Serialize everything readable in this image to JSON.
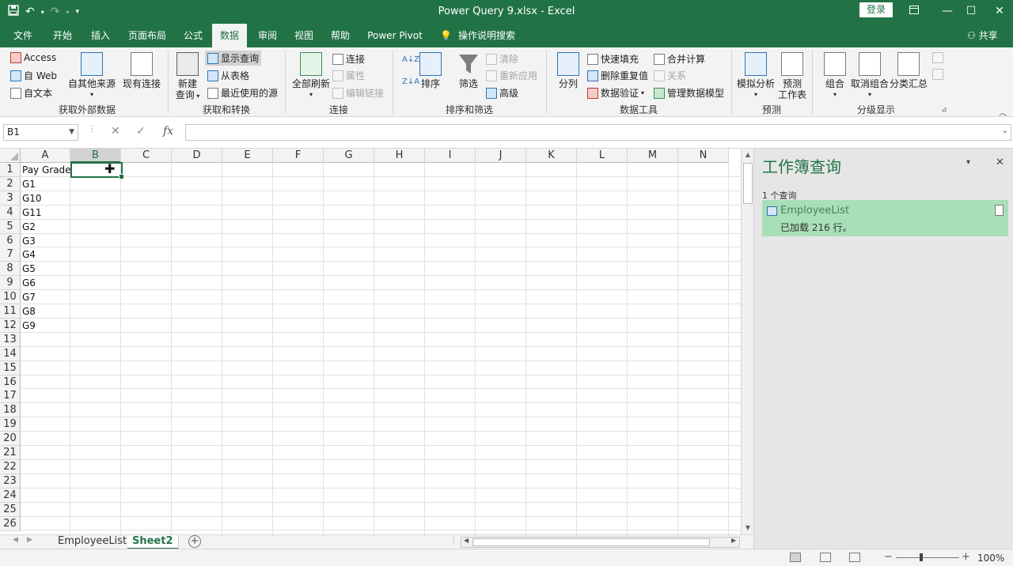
{
  "window": {
    "title": "Power Query 9.xlsx  -  Excel",
    "login_label": "登录",
    "share_label": "共享"
  },
  "tabs": [
    {
      "label": "文件"
    },
    {
      "label": "开始"
    },
    {
      "label": "插入"
    },
    {
      "label": "页面布局"
    },
    {
      "label": "公式"
    },
    {
      "label": "数据"
    },
    {
      "label": "审阅"
    },
    {
      "label": "视图"
    },
    {
      "label": "帮助"
    },
    {
      "label": "Power Pivot"
    }
  ],
  "tell_me": "操作说明搜索",
  "ribbon": {
    "external": {
      "access": "Access",
      "web": "自 Web",
      "text": "自文本",
      "other_sources": "自其他来源",
      "existing_connections": "现有连接",
      "group_label": "获取外部数据"
    },
    "transform": {
      "new_query_line1": "新建",
      "new_query_line2": "查询",
      "show_queries": "显示查询",
      "from_table": "从表格",
      "recent_sources": "最近使用的源",
      "group_label": "获取和转换"
    },
    "connections": {
      "refresh_all": "全部刷新",
      "connections": "连接",
      "properties": "属性",
      "edit_links": "编辑链接",
      "group_label": "连接"
    },
    "sort_filter": {
      "sort": "排序",
      "filter": "筛选",
      "clear": "清除",
      "reapply": "重新应用",
      "advanced": "高级",
      "group_label": "排序和筛选"
    },
    "data_tools": {
      "text_to_columns": "分列",
      "flash_fill": "快速填充",
      "remove_duplicates": "删除重复值",
      "data_validation": "数据验证",
      "consolidate": "合并计算",
      "relationships": "关系",
      "manage_data_model": "管理数据模型",
      "group_label": "数据工具"
    },
    "forecast": {
      "what_if": "模拟分析",
      "forecast_line1": "预测",
      "forecast_line2": "工作表",
      "group_label": "预测"
    },
    "outline": {
      "group": "组合",
      "ungroup": "取消组合",
      "subtotal": "分类汇总",
      "group_label": "分级显示"
    }
  },
  "formula_bar": {
    "name_box": "B1",
    "fx": "fx",
    "value": ""
  },
  "grid": {
    "columns": [
      "A",
      "B",
      "C",
      "D",
      "E",
      "F",
      "G",
      "H",
      "I",
      "J",
      "K",
      "L",
      "M",
      "N"
    ],
    "rows": [
      "1",
      "2",
      "3",
      "4",
      "5",
      "6",
      "7",
      "8",
      "9",
      "10",
      "11",
      "12",
      "13",
      "14",
      "15",
      "16",
      "17",
      "18",
      "19",
      "20",
      "21",
      "22",
      "23",
      "24",
      "25",
      "26"
    ],
    "selected_column": "B",
    "active_cell": "B1",
    "cells_col_a": [
      "Pay Grade",
      "G1",
      "G10",
      "G11",
      "G2",
      "G3",
      "G4",
      "G5",
      "G6",
      "G7",
      "G8",
      "G9"
    ]
  },
  "pane": {
    "title": "工作簿查询",
    "count_text": "1 个查询",
    "query_name": "EmployeeList",
    "query_info": "已加载 216 行。"
  },
  "sheets": [
    {
      "name": "EmployeeList",
      "active": false
    },
    {
      "name": "Sheet2",
      "active": true
    }
  ],
  "status": {
    "zoom": "100%"
  },
  "colors": {
    "excel_green": "#217346",
    "query_highlight": "#a9dfb8"
  }
}
